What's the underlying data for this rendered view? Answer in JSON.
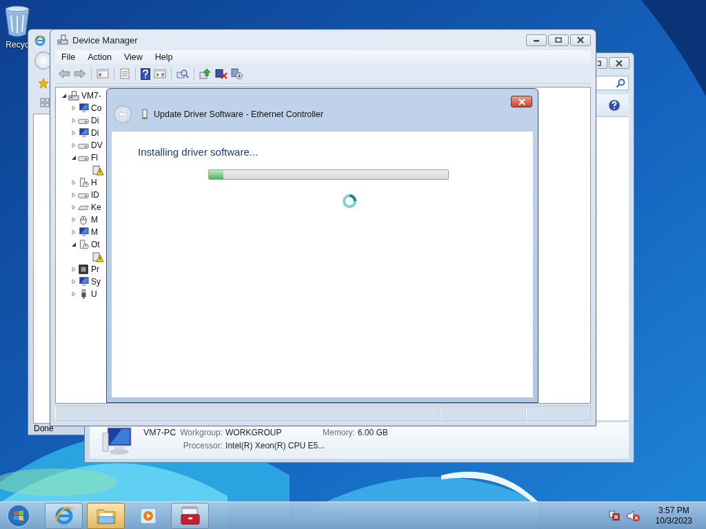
{
  "desktop": {
    "icons": [
      {
        "label": "Recyc"
      }
    ]
  },
  "browser_window": {
    "status": "Done"
  },
  "system_window": {
    "computer_name": "VM7-PC",
    "fields": [
      {
        "label": "Workgroup:",
        "value": "WORKGROUP"
      },
      {
        "label": "Memory:",
        "value": "6.00 GB"
      },
      {
        "label": "Processor:",
        "value": "Intel(R) Xeon(R) CPU E5..."
      }
    ]
  },
  "device_manager": {
    "title": "Device Manager",
    "menu": [
      "File",
      "Action",
      "View",
      "Help"
    ],
    "tree": {
      "label": "VM7-",
      "kind": "computer",
      "expanded": true,
      "children": [
        {
          "label": "Co",
          "kind": "monitor",
          "expanded": false
        },
        {
          "label": "Di",
          "kind": "drive",
          "expanded": false
        },
        {
          "label": "Di",
          "kind": "monitor",
          "expanded": false
        },
        {
          "label": "DV",
          "kind": "drive",
          "expanded": false
        },
        {
          "label": "Fl",
          "kind": "drive",
          "expanded": true,
          "children": [
            {
              "kind": "warning"
            }
          ]
        },
        {
          "label": "H",
          "kind": "device",
          "expanded": false
        },
        {
          "label": "ID",
          "kind": "drive",
          "expanded": false
        },
        {
          "label": "Ke",
          "kind": "keyboard",
          "expanded": false
        },
        {
          "label": "M",
          "kind": "mouse",
          "expanded": false
        },
        {
          "label": "M",
          "kind": "monitor",
          "expanded": false
        },
        {
          "label": "Ot",
          "kind": "device",
          "expanded": true,
          "children": [
            {
              "kind": "warning"
            }
          ]
        },
        {
          "label": "Pr",
          "kind": "chip",
          "expanded": false
        },
        {
          "label": "Sy",
          "kind": "monitor",
          "expanded": false
        },
        {
          "label": "U",
          "kind": "usb",
          "expanded": false
        }
      ]
    }
  },
  "dialog": {
    "title": "Update Driver Software - Ethernet Controller",
    "heading": "Installing driver software...",
    "progress": {
      "level": 0.06
    }
  },
  "taskbar": {
    "apps": [
      {
        "kind": "browser",
        "running": true,
        "selected": false
      },
      {
        "kind": "folder",
        "running": true,
        "selected": true
      },
      {
        "kind": "media",
        "running": false,
        "selected": false
      },
      {
        "kind": "toolbox",
        "running": true,
        "selected": false
      }
    ],
    "clock": {
      "time": "3:57 PM",
      "date": "10/3/2023"
    }
  }
}
